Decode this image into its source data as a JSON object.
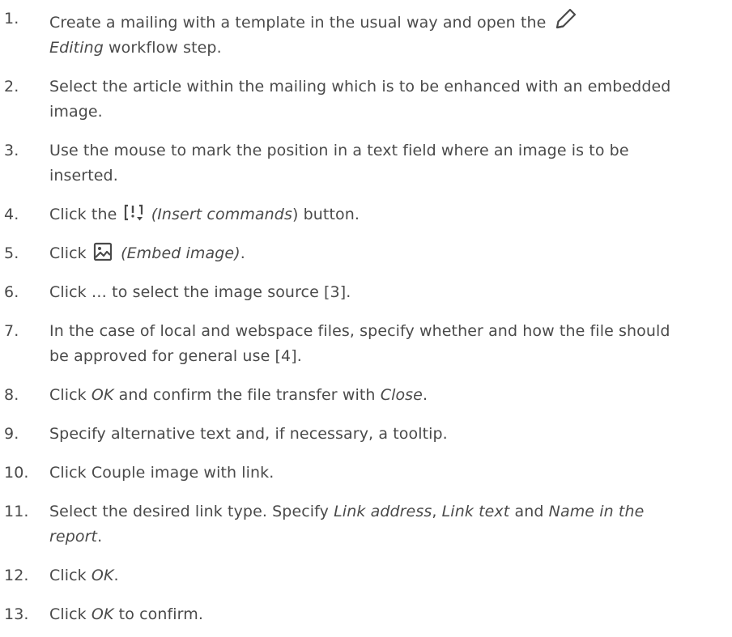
{
  "steps": [
    {
      "num": "1.",
      "a": "Create a mailing with a template in the usual way and open the",
      "icon": "pencil-icon",
      "b_em": "Editing",
      "c": " workflow step."
    },
    {
      "num": "2.",
      "text": "Select the article within the mailing which is to be enhanced with an embedded image."
    },
    {
      "num": "3.",
      "text": "Use the mouse to mark the position in a text field where an image is to be inserted."
    },
    {
      "num": "4.",
      "a": "Click the",
      "icon": "insert-commands-icon",
      "b_em": "(Insert commands",
      "c": ") button."
    },
    {
      "num": "5.",
      "a": "Click",
      "icon": "image-icon",
      "b_em": "(Embed image)",
      "c": "."
    },
    {
      "num": "6.",
      "text": "Click … to select the image source [3]."
    },
    {
      "num": "7.",
      "text": "In the case of local and webspace files, specify whether and how the file should be approved for general use [4]."
    },
    {
      "num": "8.",
      "a": "Click ",
      "b_em": "OK",
      "c": " and confirm the file transfer with ",
      "d_em": "Close",
      "e": "."
    },
    {
      "num": "9.",
      "text": "Specify alternative text and, if necessary, a tooltip."
    },
    {
      "num": "10.",
      "text": "Click Couple image with link."
    },
    {
      "num": "11.",
      "a": "Select the desired link type. Specify ",
      "b_em": "Link address",
      "c": ", ",
      "d_em": "Link text",
      "e": " and ",
      "f_em": "Name in the report",
      "g": "."
    },
    {
      "num": "12.",
      "a": "Click ",
      "b_em": "OK",
      "c": "."
    },
    {
      "num": "13.",
      "a": "Click ",
      "b_em": "OK",
      "c": " to confirm."
    }
  ]
}
